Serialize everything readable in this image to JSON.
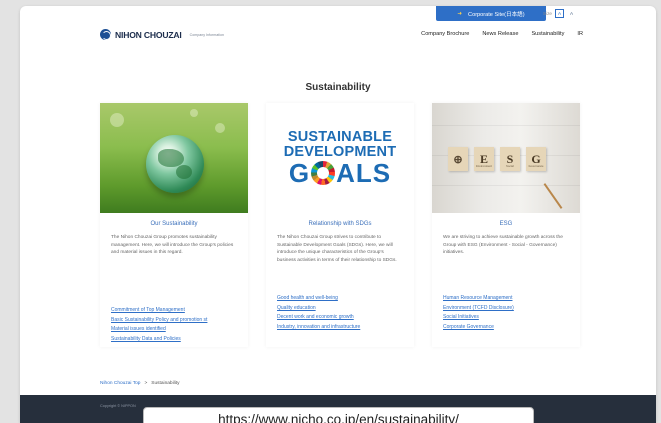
{
  "topbar": {
    "corporate_site": "Corporate Site(日本語)",
    "text_size_label": "Size",
    "size_a": "A",
    "size_a_large": "A"
  },
  "header": {
    "logo": "NIHON CHOUZAI",
    "logo_sub": "Company Information",
    "nav": [
      "Company Brochure",
      "News Release",
      "Sustainability",
      "IR"
    ]
  },
  "page_title": "Sustainability",
  "cards": [
    {
      "title": "Our Sustainability",
      "desc": "The Nihon Chouzai Group promotes sustainability management. Here, we will introduce the Group's policies and material issues in this regard.",
      "links": [
        "Commitment of Top Management",
        "Basic Sustainability Policy and promotion st",
        "Material issues identified",
        "Sustainability Data and Policies"
      ]
    },
    {
      "title": "Relationship with SDGs",
      "desc": "The Nihon Chouzai Group strives to contribute to Sustainable Development Goals (SDGs). Here, we will introduce the unique characteristics of the Group's business activities in terms of their relationship to SDGs.",
      "links": [
        "Good health and well-being",
        "Quality education",
        "Decent work and economic growth",
        "Industry, innovation and infrastructure"
      ],
      "image_text": [
        "SUSTAINABLE",
        "DEVELOPMENT",
        "G",
        "ALS"
      ]
    },
    {
      "title": "ESG",
      "desc": "We are striving to achieve sustainable growth across the Group with ESG (Environment - Social - Governance) initiatives.",
      "links": [
        "Human Resource Management",
        "Environment (TCFD Disclosure)",
        "Social Initiatives",
        "Corporate Governance"
      ],
      "image_letters": [
        "E",
        "S",
        "G"
      ],
      "image_sub": [
        "Environment",
        "Social",
        "Governance"
      ]
    }
  ],
  "breadcrumb": [
    "Nihon Chouzai Top",
    ">",
    "Sustainability"
  ],
  "footer": {
    "copyright": "Copyright © NIPPON"
  },
  "url": "https://www.nicho.co.jp/en/sustainability/",
  "colors": {
    "accent": "#2e6fc7",
    "footer": "#262f3c",
    "sdg_blue": "#1d6cb4"
  }
}
